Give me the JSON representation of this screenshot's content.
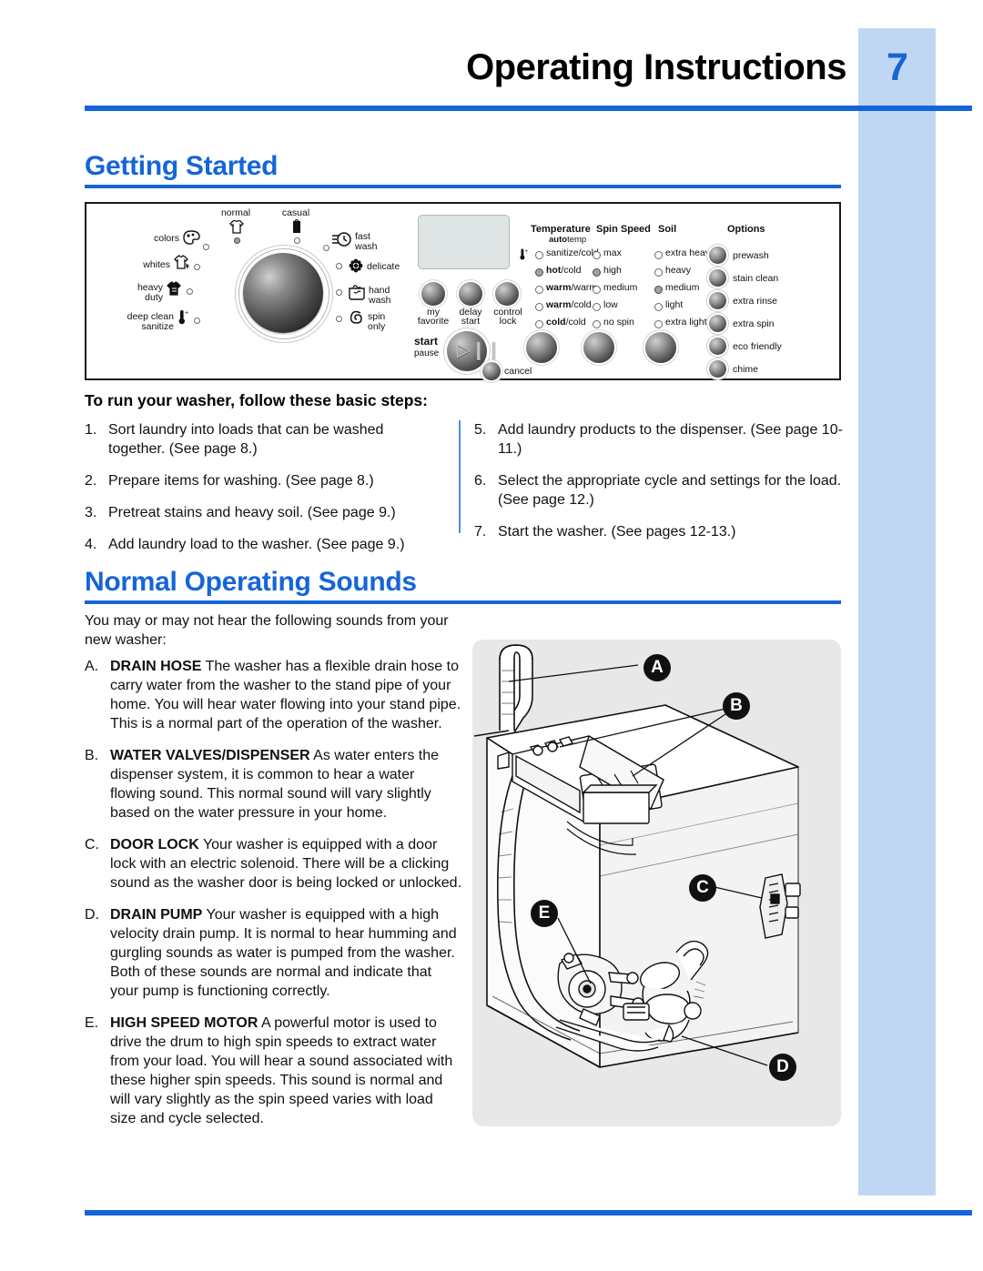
{
  "header": {
    "title": "Operating Instructions",
    "page_number": "7",
    "accent_color": "#1565d8",
    "band_color": "#bfd7f2"
  },
  "sections": {
    "getting_started": {
      "heading": "Getting Started",
      "subheading": "To run your washer, follow these basic steps:",
      "steps_left": [
        {
          "num": "1.",
          "text": "Sort laundry into loads that can be washed together. (See page 8.)"
        },
        {
          "num": "2.",
          "text": "Prepare items for washing. (See page 8.)"
        },
        {
          "num": "3.",
          "text": "Pretreat stains and heavy soil. (See page 9.)"
        },
        {
          "num": "4.",
          "text": "Add laundry load to the washer. (See page 9.)"
        }
      ],
      "steps_right": [
        {
          "num": "5.",
          "text": "Add laundry products to the dispenser. (See page 10-11.)"
        },
        {
          "num": "6.",
          "text": "Select the appropriate cycle and settings for the load. (See page 12.)"
        },
        {
          "num": "7.",
          "text": "Start the washer. (See pages 12-13.)"
        }
      ]
    },
    "normal_sounds": {
      "heading": "Normal Operating Sounds",
      "intro": "You may or may not hear the following sounds from your new washer:",
      "items": [
        {
          "letter": "A.",
          "term": "DRAIN HOSE",
          "text": "The washer has a flexible drain hose to carry water from the washer to the stand pipe of your home. You will hear water flowing into your stand pipe. This is a normal part of the operation of the washer."
        },
        {
          "letter": "B.",
          "term": "WATER VALVES/DISPENSER",
          "text": "As water enters the dispenser system, it is common to hear a water flowing sound. This normal sound will vary slightly based on the water pressure in your home."
        },
        {
          "letter": "C.",
          "term": "DOOR LOCK",
          "text": "Your washer is equipped with a door lock with an electric solenoid. There will be a clicking sound as the washer door is being locked or unlocked."
        },
        {
          "letter": "D.",
          "term": "DRAIN PUMP",
          "text": "Your washer is equipped with a high velocity drain pump. It is normal to hear humming and gurgling sounds as water is pumped from the washer. Both of these sounds are normal and indicate that your pump is functioning correctly."
        },
        {
          "letter": "E.",
          "term": "HIGH SPEED MOTOR",
          "text": "A powerful motor is used to drive the drum to high spin speeds to extract water from your load. You will hear a sound associated with these higher spin speeds. This sound is normal and will vary slightly as the spin speed varies with load size and cycle selected."
        }
      ]
    }
  },
  "control_panel": {
    "cycle_labels": [
      {
        "text": "normal",
        "selected": true
      },
      {
        "text": "casual",
        "selected": false
      },
      {
        "text": "fast wash",
        "selected": false
      },
      {
        "text": "delicate",
        "selected": false
      },
      {
        "text": "hand wash",
        "selected": false
      },
      {
        "text": "spin only",
        "selected": false
      },
      {
        "text": "deep clean sanitize",
        "selected": false
      },
      {
        "text": "heavy duty",
        "selected": false
      },
      {
        "text": "whites",
        "selected": false
      },
      {
        "text": "colors",
        "selected": false
      }
    ],
    "columns": [
      {
        "title": "Temperature",
        "subtitle_bold": "auto",
        "subtitle_rest": "temp",
        "options": [
          {
            "bold": "",
            "rest": "sanitize/cold",
            "selected": false
          },
          {
            "bold": "hot",
            "rest": "/cold",
            "selected": true
          },
          {
            "bold": "warm",
            "rest": "/warm",
            "selected": false
          },
          {
            "bold": "warm",
            "rest": "/cold",
            "selected": false
          },
          {
            "bold": "cold",
            "rest": "/cold",
            "selected": false
          }
        ]
      },
      {
        "title": "Spin Speed",
        "subtitle_bold": "",
        "subtitle_rest": "",
        "options": [
          {
            "bold": "",
            "rest": "max",
            "selected": false
          },
          {
            "bold": "",
            "rest": "high",
            "selected": true
          },
          {
            "bold": "",
            "rest": "medium",
            "selected": false
          },
          {
            "bold": "",
            "rest": "low",
            "selected": false
          },
          {
            "bold": "",
            "rest": "no spin",
            "selected": false
          }
        ]
      },
      {
        "title": "Soil",
        "subtitle_bold": "",
        "subtitle_rest": "",
        "options": [
          {
            "bold": "",
            "rest": "extra heavy",
            "selected": false
          },
          {
            "bold": "",
            "rest": "heavy",
            "selected": false
          },
          {
            "bold": "",
            "rest": "medium",
            "selected": true
          },
          {
            "bold": "",
            "rest": "light",
            "selected": false
          },
          {
            "bold": "",
            "rest": "extra light",
            "selected": false
          }
        ]
      }
    ],
    "options_title": "Options",
    "options": [
      "prewash",
      "stain clean",
      "extra rinse",
      "extra spin",
      "eco friendly",
      "chime"
    ],
    "center_buttons": [
      {
        "line1": "my",
        "line2": "favorite"
      },
      {
        "line1": "delay",
        "line2": "start"
      },
      {
        "line1": "control",
        "line2": "lock"
      }
    ],
    "start_label": "start",
    "start_sublabel": "pause",
    "cancel_label": "cancel"
  },
  "illustration": {
    "callouts": [
      "A",
      "B",
      "C",
      "E",
      "D"
    ]
  }
}
